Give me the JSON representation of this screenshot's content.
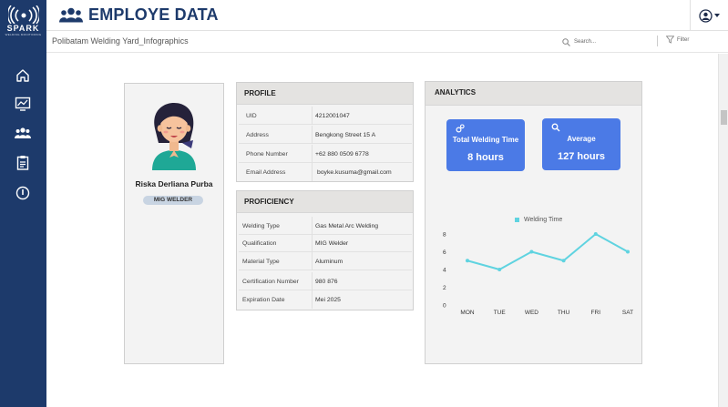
{
  "brand": {
    "name": "SPARK",
    "sub": "WELDING MONITORING"
  },
  "header": {
    "title": "EMPLOYE DATA"
  },
  "subbar": {
    "breadcrumb": "Polibatam Welding Yard_Infographics",
    "search_placeholder": "Search...",
    "filter_label": "Filter"
  },
  "sidebar": {
    "items": [
      "home-icon",
      "monitor-chart-icon",
      "users-icon",
      "clipboard-icon",
      "power-icon"
    ]
  },
  "employee": {
    "name": "Riska Derliana Purba",
    "role": "MIG WELDER"
  },
  "profile": {
    "title": "PROFILE",
    "rows": [
      {
        "key": "UID",
        "value": "4212001047"
      },
      {
        "key": "Address",
        "value": "Bengkong Street 15 A"
      },
      {
        "key": "Phone Number",
        "value": "+62 880 0509 6778"
      },
      {
        "key": "Email Address",
        "value": "boyke.kusuma@gmail.com"
      }
    ]
  },
  "proficiency": {
    "title": "PROFICIENCY",
    "rows": [
      {
        "key": "Welding Type",
        "value": "Gas Metal Arc Welding"
      },
      {
        "key": "Qualification",
        "value": "MIG Welder"
      },
      {
        "key": "Material Type",
        "value": "Aluminum"
      },
      {
        "key": "Certification Number",
        "value": "980 876"
      },
      {
        "key": "Expiration Date",
        "value": "Mei 2025"
      }
    ]
  },
  "analytics": {
    "title": "ANALYTICS",
    "cards": [
      {
        "label": "Total Welding Time",
        "value": "8 hours",
        "icon": "gears-icon"
      },
      {
        "label": "Average",
        "value": "127 hours",
        "icon": "magnifier-icon"
      }
    ]
  },
  "colors": {
    "sidebar": "#1d3a6b",
    "accent": "#4b7ae6",
    "line": "#5fd3e0"
  },
  "chart_data": {
    "type": "line",
    "categories": [
      "MON",
      "TUE",
      "WED",
      "THU",
      "FRI",
      "SAT"
    ],
    "series": [
      {
        "name": "Welding Time",
        "values": [
          5,
          4,
          6,
          5,
          8,
          6
        ]
      }
    ],
    "yticks": [
      "8",
      "6",
      "4",
      "2",
      "0"
    ],
    "ylim": [
      0,
      8
    ],
    "grid": false,
    "legend": "top"
  }
}
